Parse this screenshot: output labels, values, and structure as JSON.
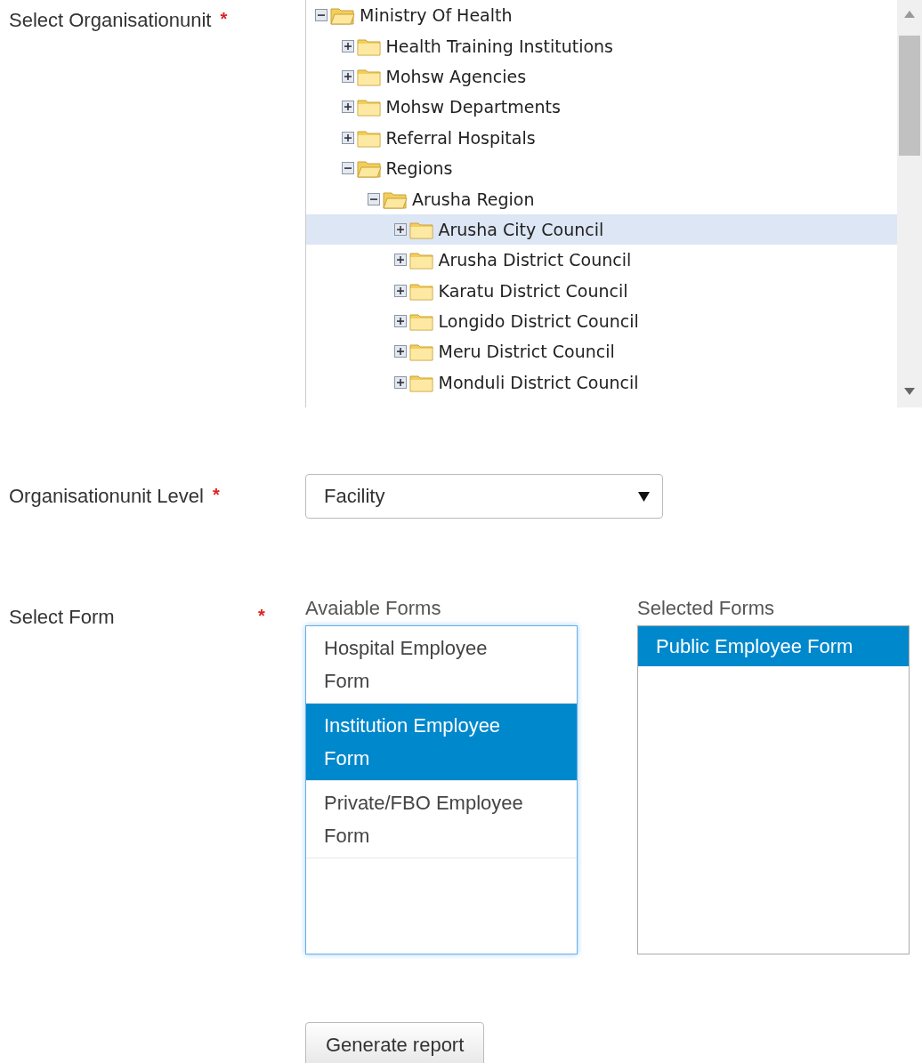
{
  "org_unit": {
    "label": "Select Organisationunit",
    "required_mark": "*",
    "tree": [
      {
        "label": "Ministry Of Health",
        "expanded": true,
        "selected": false,
        "children": [
          {
            "label": "Health Training Institutions",
            "expanded": false,
            "selected": false
          },
          {
            "label": "Mohsw Agencies",
            "expanded": false,
            "selected": false
          },
          {
            "label": "Mohsw Departments",
            "expanded": false,
            "selected": false
          },
          {
            "label": "Referral Hospitals",
            "expanded": false,
            "selected": false
          },
          {
            "label": "Regions",
            "expanded": true,
            "selected": false,
            "children": [
              {
                "label": "Arusha Region",
                "expanded": true,
                "selected": false,
                "children": [
                  {
                    "label": "Arusha City Council",
                    "expanded": false,
                    "selected": true
                  },
                  {
                    "label": "Arusha District Council",
                    "expanded": false,
                    "selected": false
                  },
                  {
                    "label": "Karatu District Council",
                    "expanded": false,
                    "selected": false
                  },
                  {
                    "label": "Longido District Council",
                    "expanded": false,
                    "selected": false
                  },
                  {
                    "label": "Meru District Council",
                    "expanded": false,
                    "selected": false
                  },
                  {
                    "label": "Monduli District Council",
                    "expanded": false,
                    "selected": false
                  }
                ]
              }
            ]
          }
        ]
      }
    ]
  },
  "level": {
    "label": "Organisationunit Level",
    "required_mark": "*",
    "value": "Facility"
  },
  "forms": {
    "label": "Select Form",
    "required_mark": "*",
    "available": {
      "title": "Avaiable Forms",
      "items": [
        {
          "label": "Hospital Employee Form",
          "selected": false
        },
        {
          "label": "Institution Employee Form",
          "selected": true
        },
        {
          "label": "Private/FBO Employee Form",
          "selected": false
        }
      ]
    },
    "chosen": {
      "title": "Selected Forms",
      "items": [
        {
          "label": "Public Employee Form",
          "selected": true
        }
      ]
    }
  },
  "button": "Generate report"
}
